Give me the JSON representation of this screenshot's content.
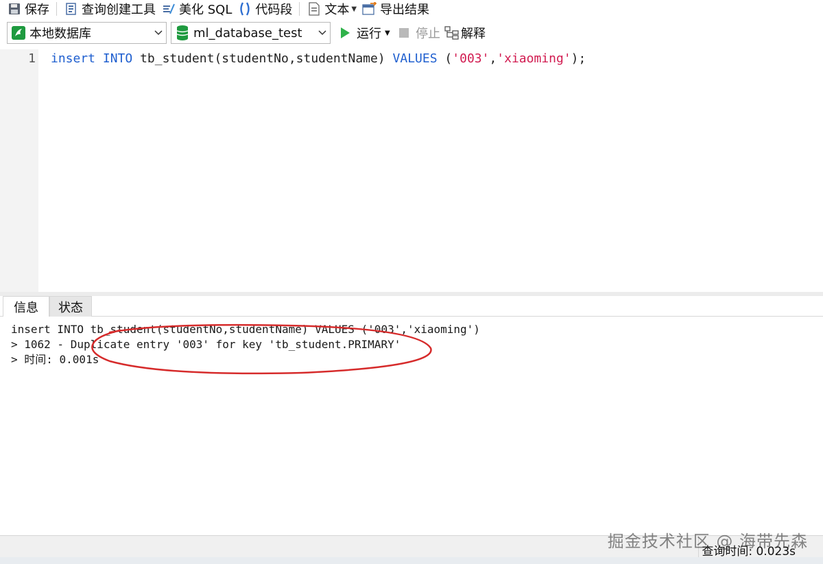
{
  "toolbar": {
    "save_label": "保存",
    "query_builder_label": "查询创建工具",
    "beautify_label": "美化 SQL",
    "snippet_label": "代码段",
    "text_label": "文本",
    "export_label": "导出结果"
  },
  "connection_bar": {
    "connection": "本地数据库",
    "database": "ml_database_test",
    "run_label": "运行",
    "stop_label": "停止",
    "explain_label": "解释"
  },
  "editor": {
    "line_number": "1",
    "code": {
      "insert": "insert",
      "into": "INTO",
      "table_call": "tb_student(studentNo,studentName)",
      "values": "VALUES",
      "open": "(",
      "str1": "'003'",
      "comma": ",",
      "str2": "'xiaoming'",
      "close": ");"
    }
  },
  "tabs": {
    "info": "信息",
    "status": "状态"
  },
  "messages": {
    "line1": "insert INTO tb_student(studentNo,studentName) VALUES ('003','xiaoming')",
    "line2": "> 1062 - Duplicate entry '003' for key 'tb_student.PRIMARY'",
    "line3": "> 时间: 0.001s"
  },
  "statusbar": {
    "query_time": "查询时间: 0.023s"
  },
  "watermark": "掘金技术社区 @ 海带先森",
  "colors": {
    "keyword": "#1f5fcf",
    "string": "#d11b50",
    "annotation_ellipse": "#d62b2b",
    "run_icon": "#2fb24a",
    "db_icon": "#1e9a3f"
  }
}
